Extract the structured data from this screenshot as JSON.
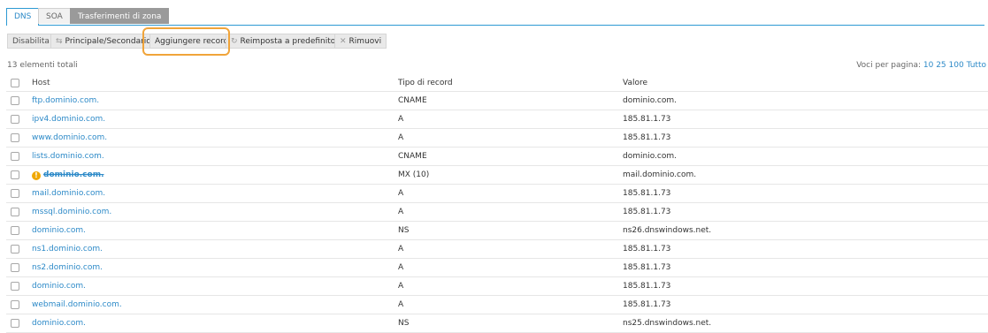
{
  "tabs": [
    {
      "label": "DNS"
    },
    {
      "label": "SOA"
    },
    {
      "label": "Trasferimenti di zona"
    }
  ],
  "toolbar": {
    "disable": "Disabilita",
    "primary_secondary": "Principale/Secondario",
    "add_record": "Aggiungere record",
    "reset_default": "Reimposta a predefinito",
    "remove": "Rimuovi"
  },
  "summary": {
    "total": "13 elementi totali",
    "per_page_label": "Voci per pagina:",
    "per_page_options": [
      "10",
      "25",
      "100",
      "Tutto"
    ]
  },
  "table": {
    "headers": {
      "host": "Host",
      "type": "Tipo di record",
      "value": "Valore"
    },
    "rows": [
      {
        "host": "ftp.dominio.com.",
        "type": "CNAME",
        "value": "dominio.com."
      },
      {
        "host": "ipv4.dominio.com.",
        "type": "A",
        "value": "185.81.1.73"
      },
      {
        "host": "www.dominio.com.",
        "type": "A",
        "value": "185.81.1.73"
      },
      {
        "host": "lists.dominio.com.",
        "type": "CNAME",
        "value": "dominio.com."
      },
      {
        "host": "dominio.com.",
        "type": "MX (10)",
        "value": "mail.dominio.com.",
        "warning": true
      },
      {
        "host": "mail.dominio.com.",
        "type": "A",
        "value": "185.81.1.73"
      },
      {
        "host": "mssql.dominio.com.",
        "type": "A",
        "value": "185.81.1.73"
      },
      {
        "host": "dominio.com.",
        "type": "NS",
        "value": "ns26.dnswindows.net."
      },
      {
        "host": "ns1.dominio.com.",
        "type": "A",
        "value": "185.81.1.73"
      },
      {
        "host": "ns2.dominio.com.",
        "type": "A",
        "value": "185.81.1.73"
      },
      {
        "host": "dominio.com.",
        "type": "A",
        "value": "185.81.1.73"
      },
      {
        "host": "webmail.dominio.com.",
        "type": "A",
        "value": "185.81.1.73"
      },
      {
        "host": "dominio.com.",
        "type": "NS",
        "value": "ns25.dnswindows.net."
      }
    ]
  },
  "colors": {
    "accent": "#2d8ac8",
    "highlight": "#f0a43a",
    "warning": "#f0a800"
  }
}
